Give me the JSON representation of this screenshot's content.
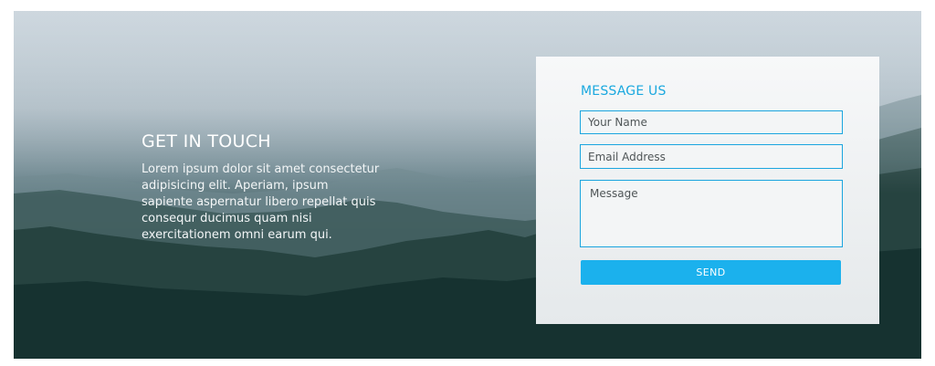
{
  "intro": {
    "title": "GET IN TOUCH",
    "body": "Lorem ipsum dolor sit amet consectetur adipisicing elit. Aperiam, ipsum sapiente aspernatur libero repellat quis consequr ducimus quam nisi exercitationem omni earum qui."
  },
  "form": {
    "title": "MESSAGE US",
    "name_placeholder": "Your Name",
    "email_placeholder": "Email Address",
    "message_placeholder": "Message",
    "send_label": "SEND"
  },
  "colors": {
    "accent": "#1bb1ed",
    "accent_text": "#1aa8df",
    "field_border": "#1ba5df"
  }
}
